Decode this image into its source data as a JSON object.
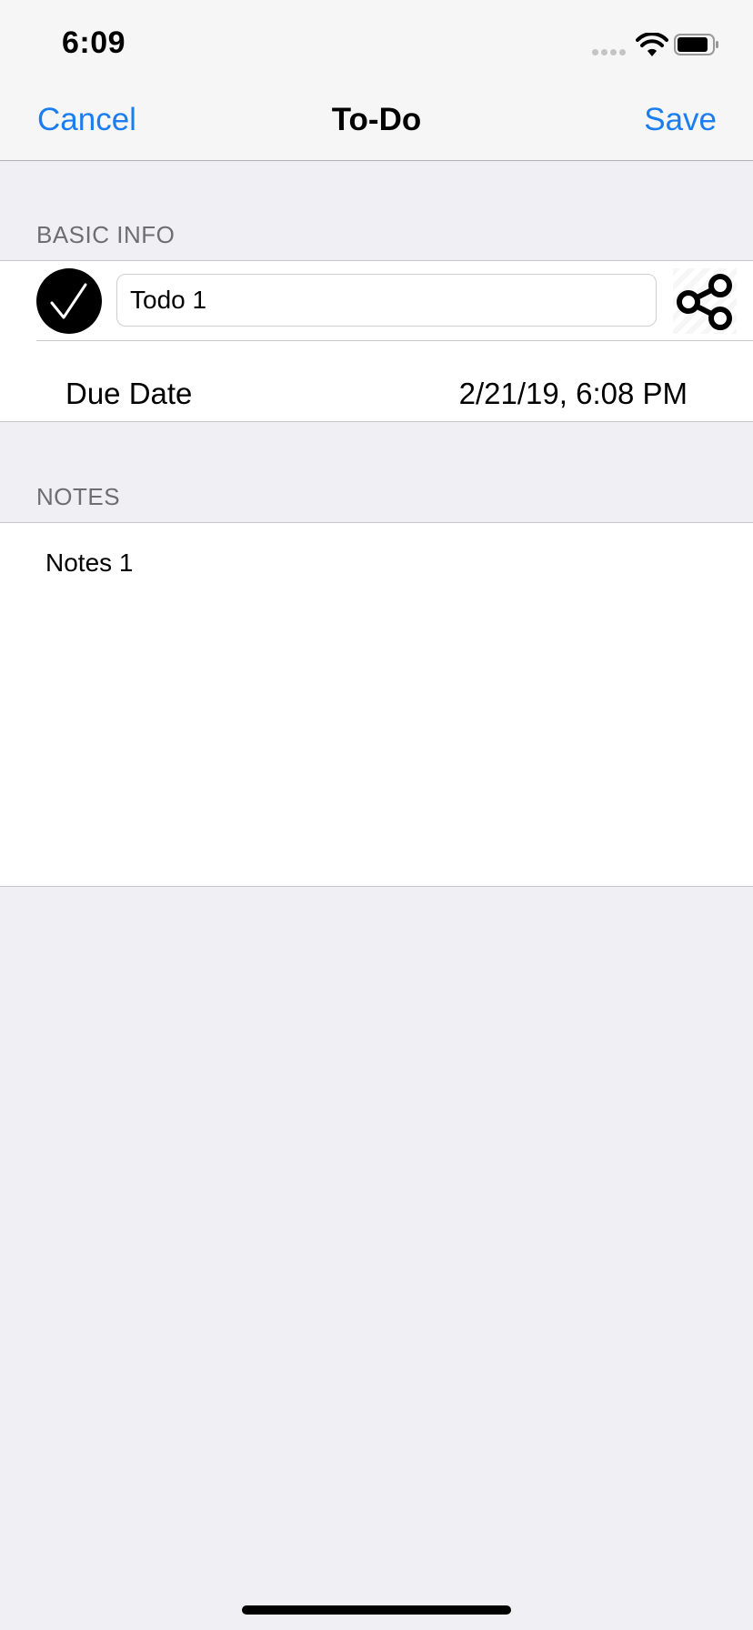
{
  "status_bar": {
    "time": "6:09",
    "icons": [
      "cellular-signal-icon",
      "wifi-icon",
      "battery-icon"
    ]
  },
  "nav": {
    "cancel_label": "Cancel",
    "title": "To-Do",
    "save_label": "Save",
    "accent_color": "#1a7ef0"
  },
  "basic_info": {
    "header": "BASIC INFO",
    "completed_icon": "checkmark-circle-icon",
    "title_value": "Todo 1",
    "share_icon": "share-icon",
    "due_date_label": "Due Date",
    "due_date_value": "2/21/19, 6:08 PM"
  },
  "notes": {
    "header": "NOTES",
    "value": "Notes 1"
  }
}
